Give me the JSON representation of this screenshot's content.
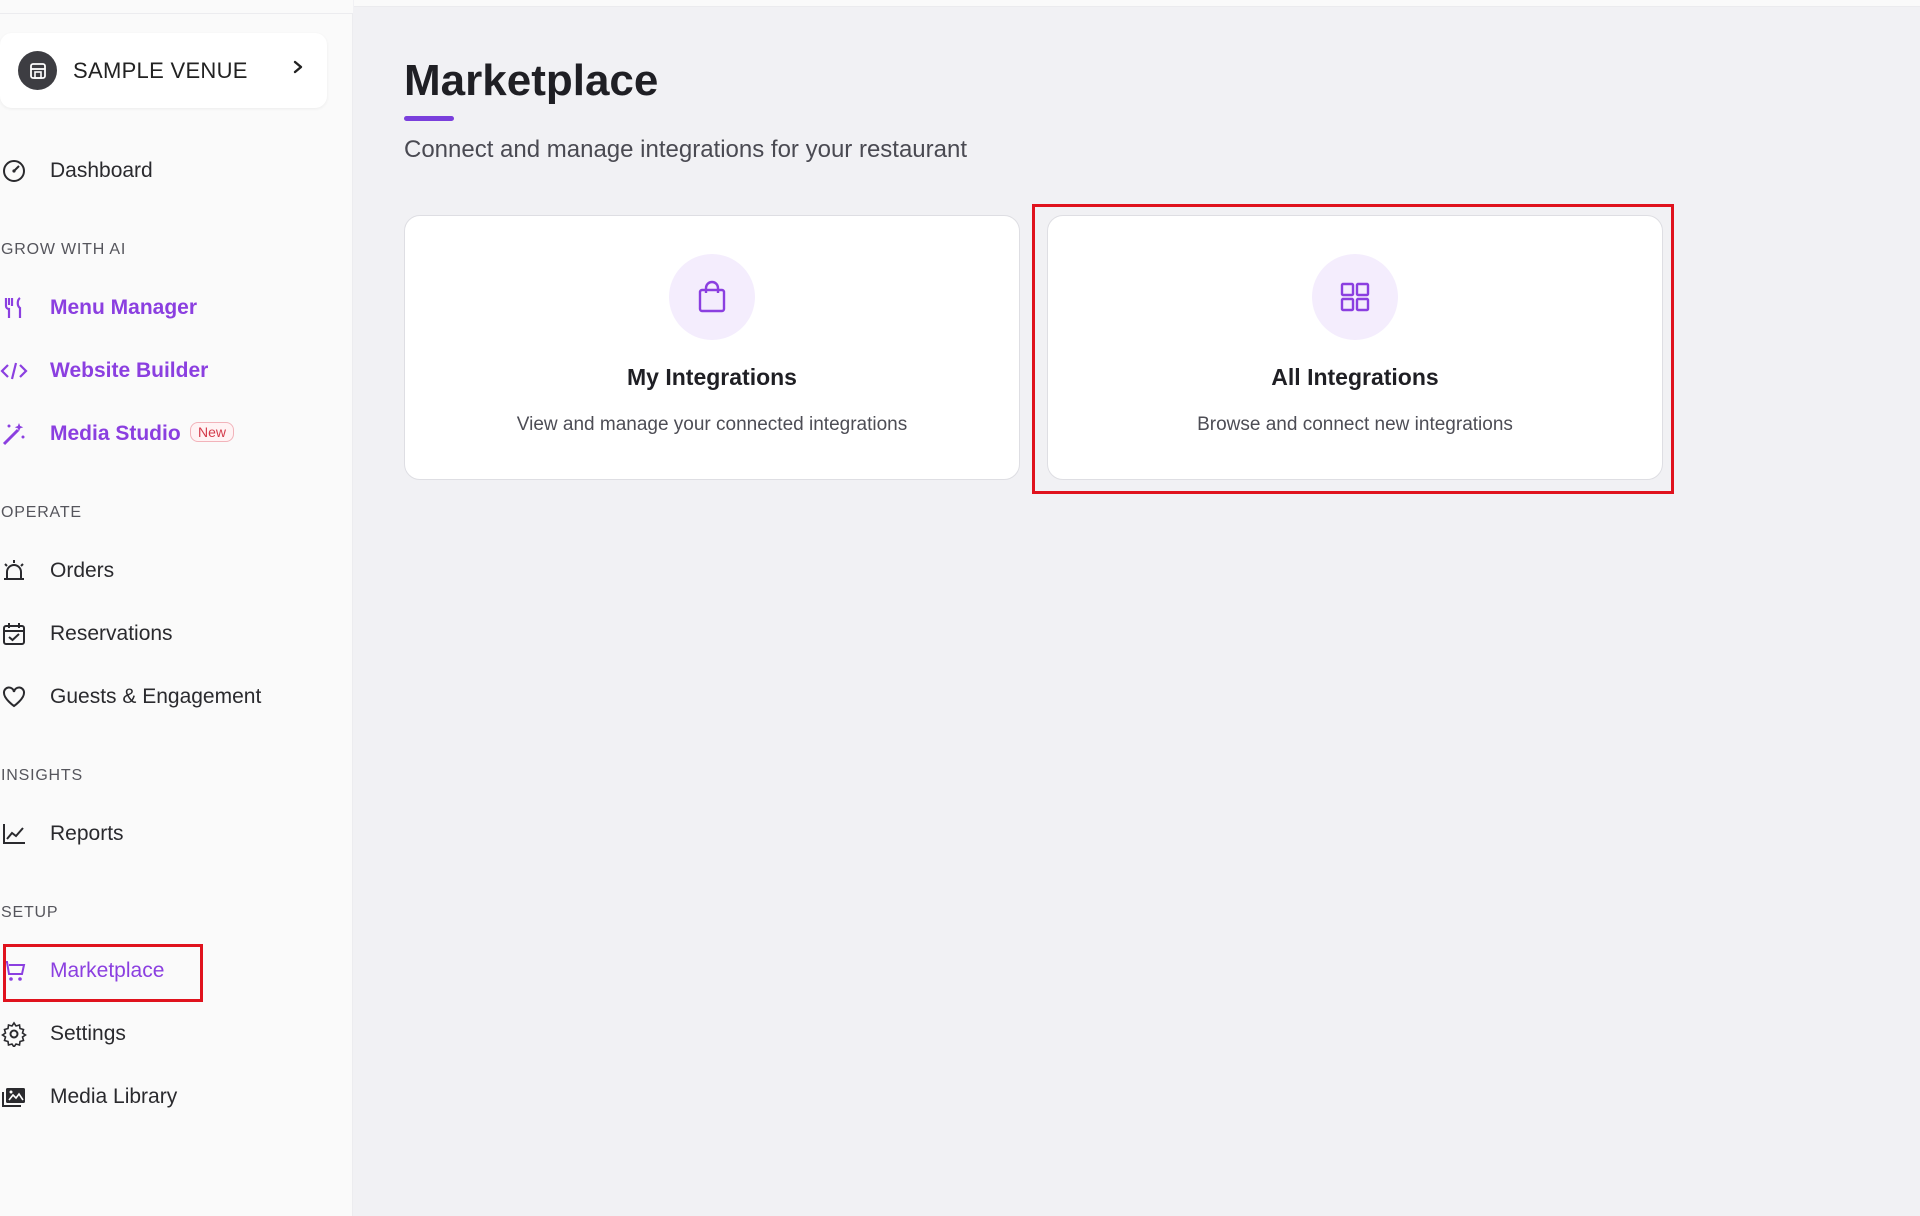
{
  "sidebar": {
    "venue": {
      "name": "SAMPLE VENUE"
    },
    "dashboard": "Dashboard",
    "sections": {
      "grow": "GROW WITH AI",
      "operate": "OPERATE",
      "insights": "INSIGHTS",
      "setup": "SETUP"
    },
    "items": {
      "menu_manager": "Menu Manager",
      "website_builder": "Website Builder",
      "media_studio": "Media Studio",
      "media_studio_badge": "New",
      "orders": "Orders",
      "reservations": "Reservations",
      "guests": "Guests & Engagement",
      "reports": "Reports",
      "marketplace": "Marketplace",
      "settings": "Settings",
      "media_library": "Media Library"
    }
  },
  "main": {
    "title": "Marketplace",
    "subtitle": "Connect and manage integrations for your restaurant",
    "cards": [
      {
        "title": "My Integrations",
        "description": "View and manage your connected integrations",
        "icon": "shopping-bag-icon"
      },
      {
        "title": "All Integrations",
        "description": "Browse and connect new integrations",
        "icon": "grid-icon"
      }
    ]
  },
  "colors": {
    "accent": "#8b3fe0",
    "highlight": "#e0121d",
    "background": "#f1f1f4"
  }
}
